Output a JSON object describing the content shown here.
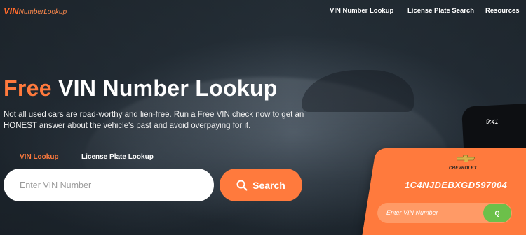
{
  "header": {
    "logo_vin": "VIN",
    "logo_rest": "NumberLookup",
    "nav": [
      {
        "label": "VIN Number Lookup"
      },
      {
        "label": "License Plate Search"
      },
      {
        "label": "Resources"
      }
    ]
  },
  "hero": {
    "title_accent": "Free",
    "title_rest": " VIN Number Lookup",
    "description": "Not all used cars are road-worthy and lien-free. Run a Free VIN check now to get an HONEST answer about the vehicle's past and avoid overpaying for it."
  },
  "tabs": [
    {
      "label": "VIN Lookup",
      "active": true
    },
    {
      "label": "License Plate Lookup",
      "active": false
    }
  ],
  "search": {
    "placeholder": "Enter VIN Number",
    "button_label": "Search",
    "icon": "search-icon"
  },
  "phone_mockup": {
    "time": "9:41",
    "brand": "CHEVROLET",
    "vin": "1C4NJDEBXGD597004",
    "input_placeholder": "Enter VIN Number",
    "go_label": "Q"
  },
  "colors": {
    "accent": "#ff7a3d",
    "go_button": "#6cc04a"
  }
}
